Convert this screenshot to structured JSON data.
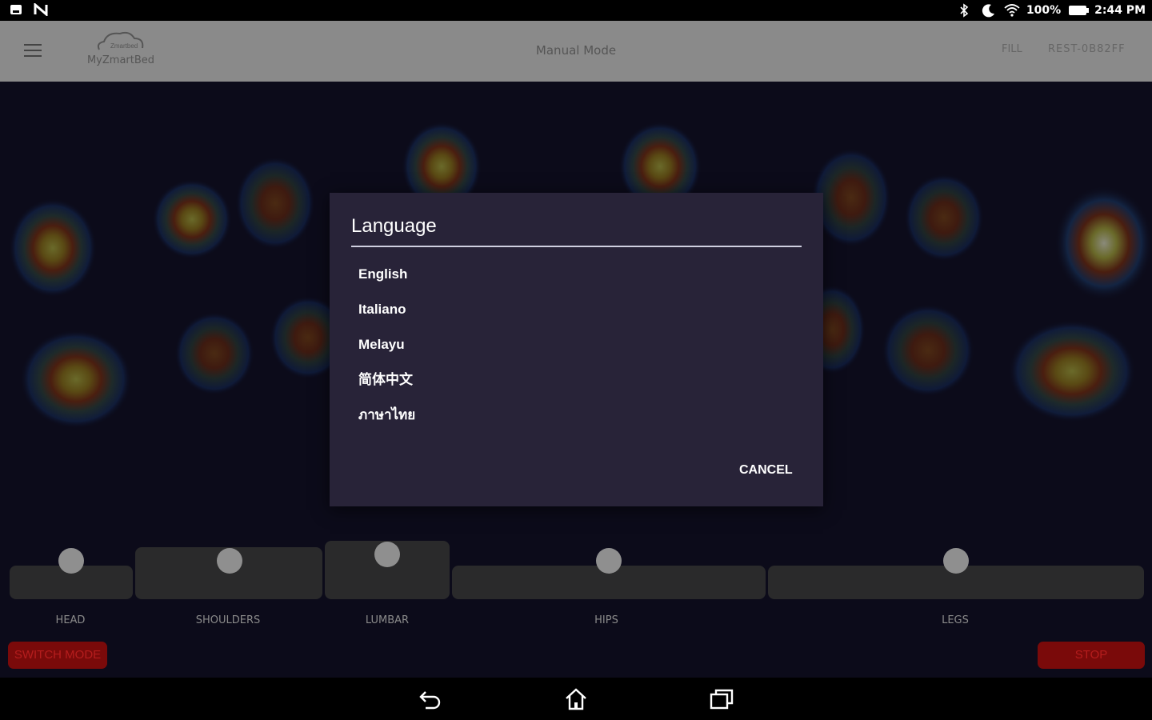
{
  "statusbar": {
    "battery": "100%",
    "time": "2:44 PM"
  },
  "appbar": {
    "logo_text": "MyZmartBed",
    "logo_brand": "Zmartbed",
    "mode_title": "Manual Mode",
    "fill_label": "FILL",
    "device_id": "REST-0B82FF"
  },
  "dialog": {
    "title": "Language",
    "options": [
      "English",
      "Italiano",
      "Melayu",
      "简体中文",
      "ภาษาไทย"
    ],
    "cancel_label": "CANCEL"
  },
  "zones": [
    {
      "label": "HEAD"
    },
    {
      "label": "SHOULDERS"
    },
    {
      "label": "LUMBAR"
    },
    {
      "label": "HIPS"
    },
    {
      "label": "LEGS"
    }
  ],
  "buttons": {
    "switch_mode": "SWITCH MODE",
    "stop": "STOP"
  },
  "colors": {
    "dialog_bg": "#282338",
    "main_bg": "#0c0b1a",
    "appbar_bg": "#8a8a8a",
    "danger": "#7a0a0a"
  }
}
